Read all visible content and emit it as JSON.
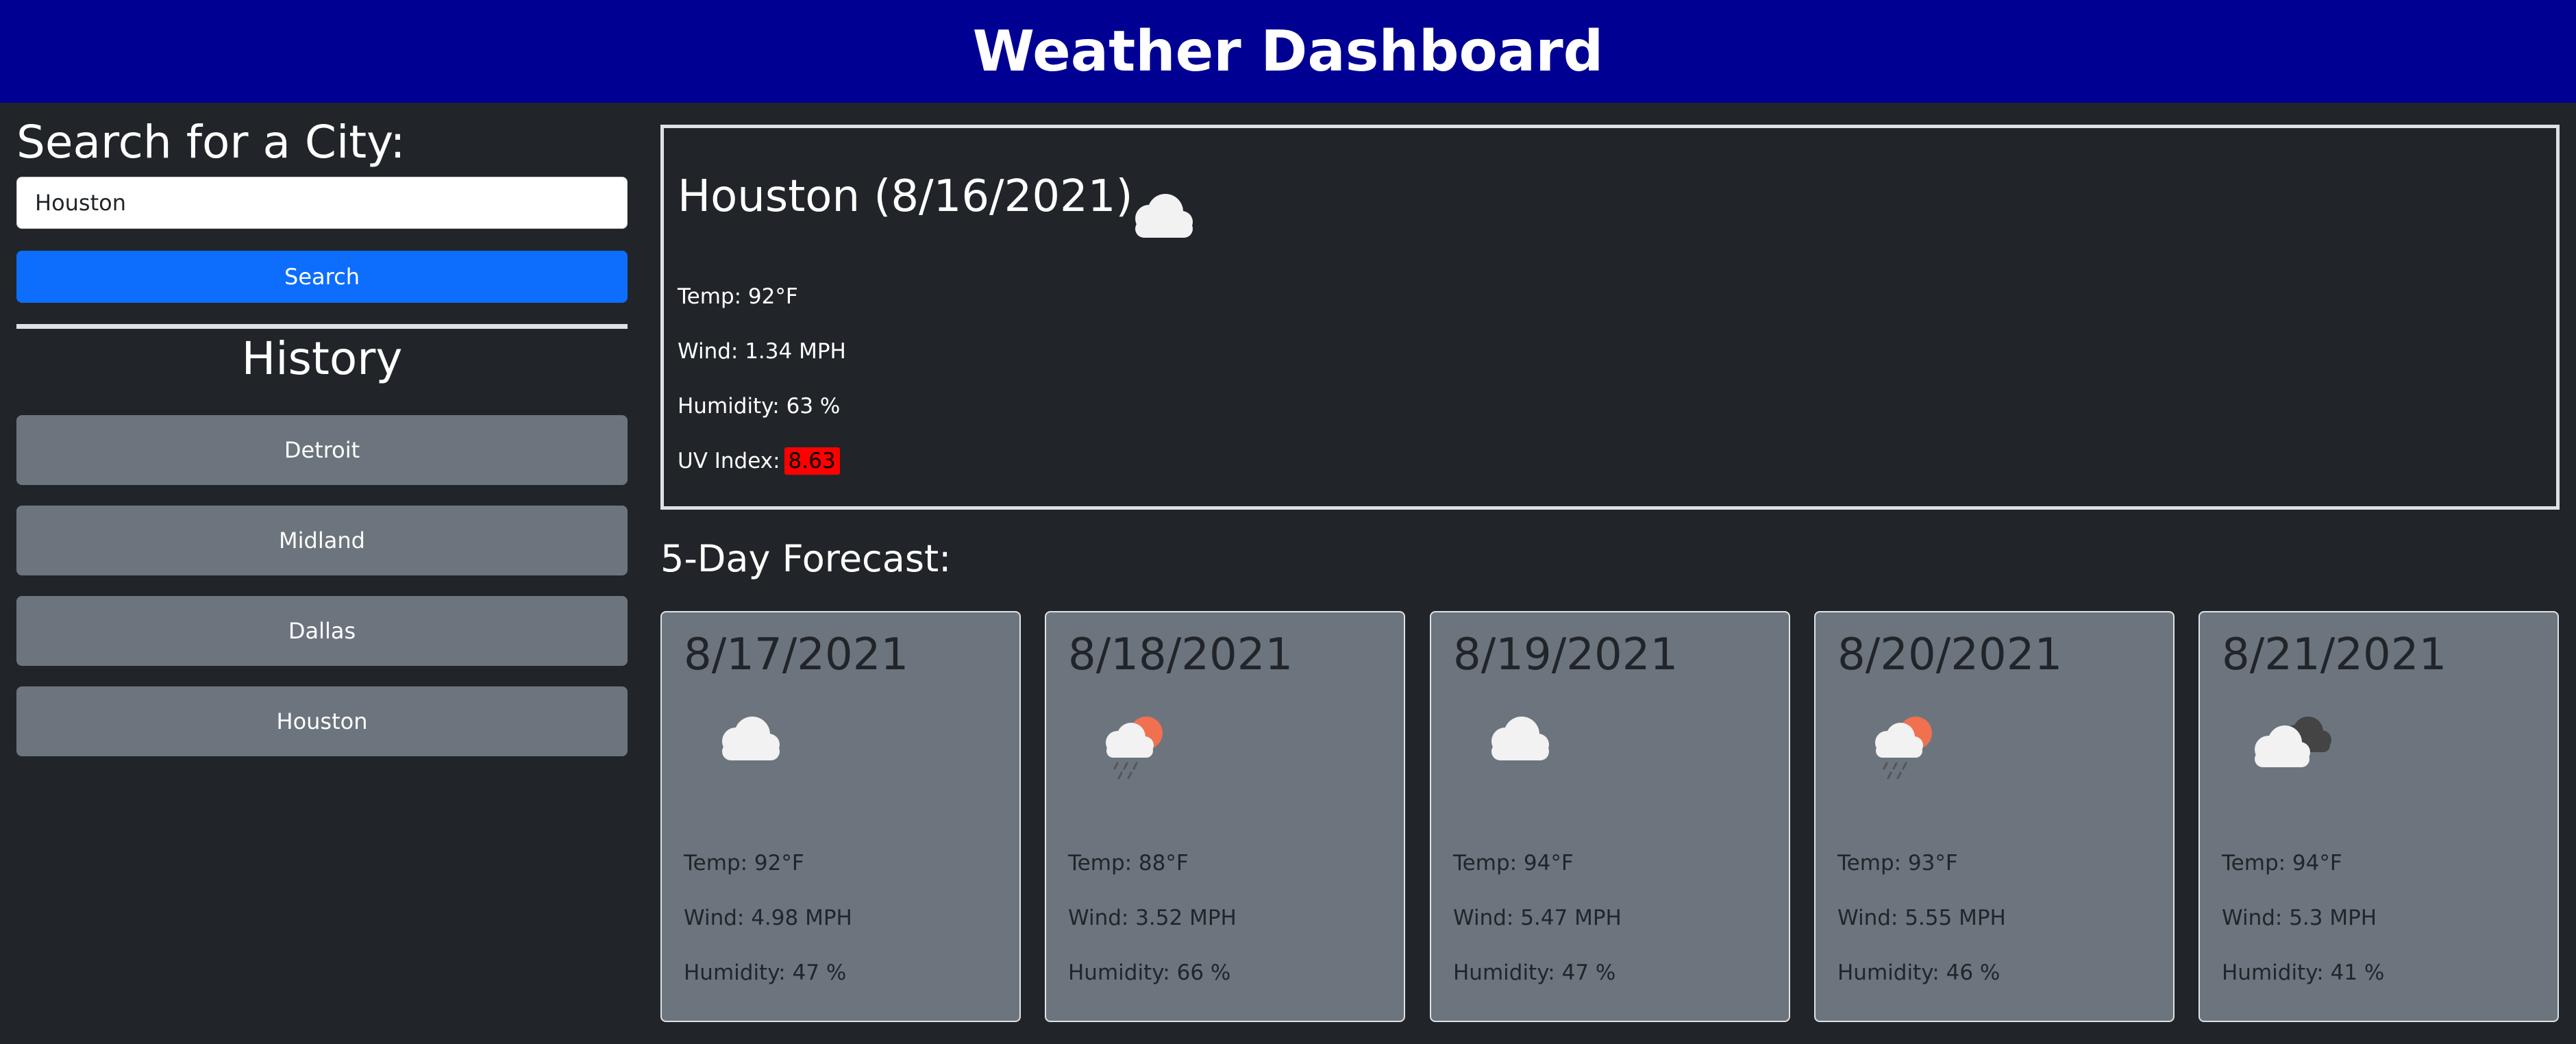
{
  "header": {
    "title": "Weather Dashboard"
  },
  "search": {
    "title": "Search for a City:",
    "input_value": "Houston",
    "button_label": "Search"
  },
  "history": {
    "title": "History",
    "items": [
      "Detroit",
      "Midland",
      "Dallas",
      "Houston"
    ]
  },
  "current": {
    "title": "Houston (8/16/2021)",
    "icon": "cloud-icon",
    "temp": "Temp: 92°F",
    "wind": "Wind: 1.34 MPH",
    "humidity": "Humidity: 63 %",
    "uv_label": "UV Index:",
    "uv_value": "8.63",
    "uv_color": "#ff0000"
  },
  "forecast": {
    "title": "5-Day Forecast:",
    "days": [
      {
        "date": "8/17/2021",
        "icon": "cloud-icon",
        "temp": "Temp: 92°F",
        "wind": "Wind: 4.98 MPH",
        "humidity": "Humidity: 47 %"
      },
      {
        "date": "8/18/2021",
        "icon": "rain-sun-icon",
        "temp": "Temp: 88°F",
        "wind": "Wind: 3.52 MPH",
        "humidity": "Humidity: 66 %"
      },
      {
        "date": "8/19/2021",
        "icon": "cloud-icon",
        "temp": "Temp: 94°F",
        "wind": "Wind: 5.47 MPH",
        "humidity": "Humidity: 47 %"
      },
      {
        "date": "8/20/2021",
        "icon": "rain-sun-icon",
        "temp": "Temp: 93°F",
        "wind": "Wind: 5.55 MPH",
        "humidity": "Humidity: 46 %"
      },
      {
        "date": "8/21/2021",
        "icon": "broken-clouds-icon",
        "temp": "Temp: 94°F",
        "wind": "Wind: 5.3 MPH",
        "humidity": "Humidity: 41 %"
      }
    ]
  },
  "colors": {
    "header_bg": "#000093",
    "page_bg": "#212529",
    "primary_button": "#0d6efd",
    "secondary": "#6c757d",
    "uv_high": "#ff0000"
  }
}
